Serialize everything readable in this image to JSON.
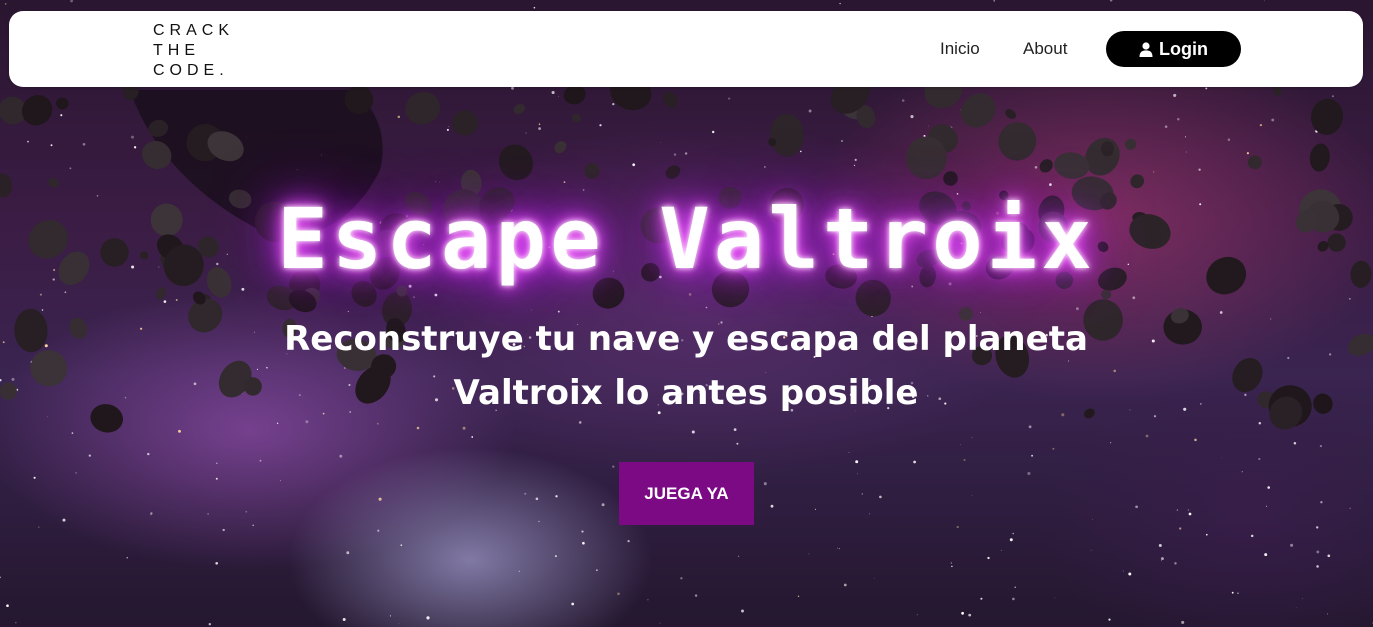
{
  "nav": {
    "logo_lines": [
      "CRACK",
      "THE",
      "CODE."
    ],
    "links": [
      {
        "label": "Inicio"
      },
      {
        "label": "About"
      }
    ],
    "login_label": "Login",
    "login_icon": "user-icon"
  },
  "hero": {
    "title": "Escape Valtroix",
    "subtitle_line1": "Reconstruye tu nave y escapa del planeta",
    "subtitle_line2": "Valtroix lo antes posible",
    "cta_label": "JUEGA YA"
  },
  "colors": {
    "cta_background": "#7b0a84",
    "title_glow": "#d63cff",
    "login_background": "#000000"
  }
}
